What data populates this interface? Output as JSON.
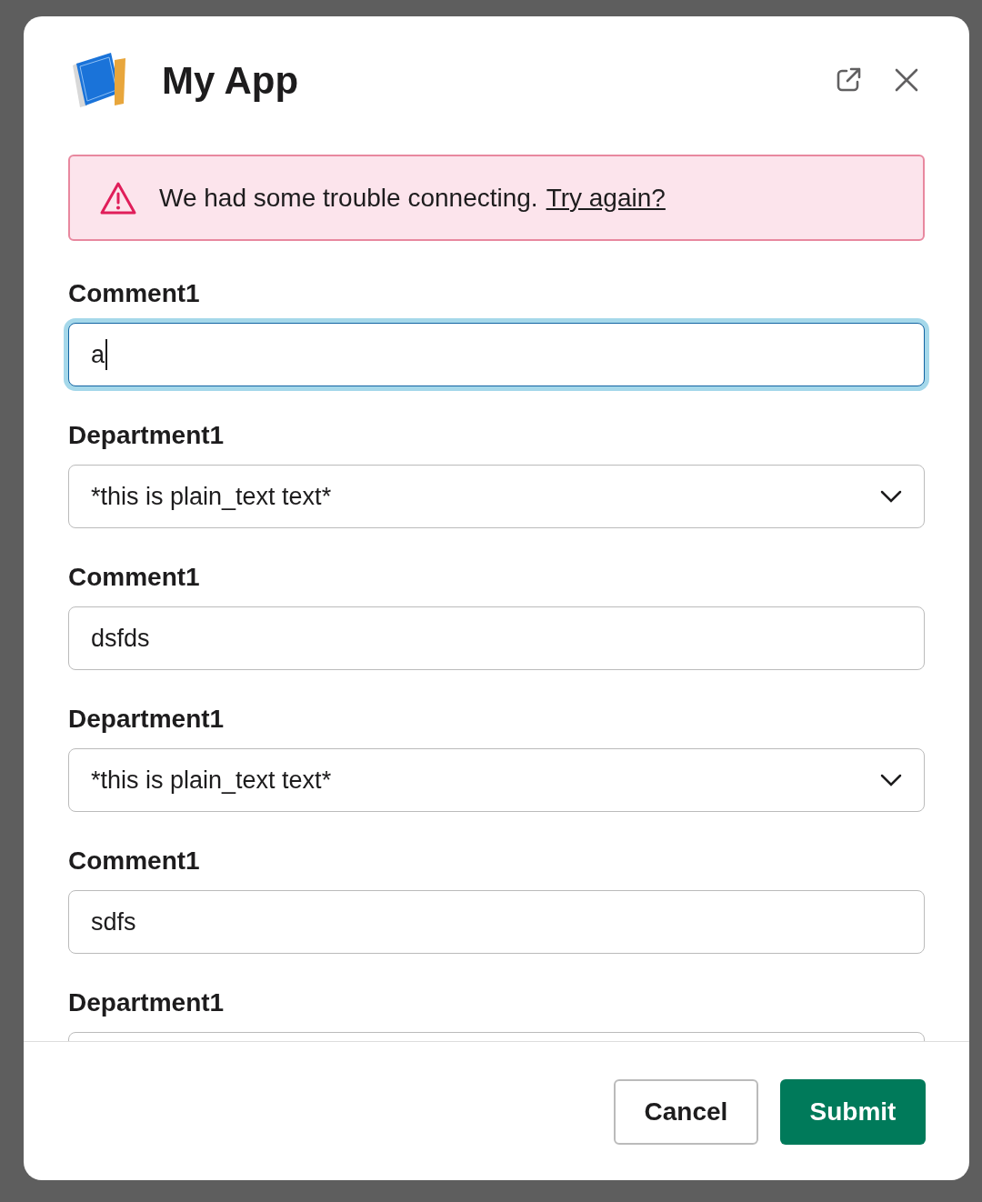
{
  "modal": {
    "title": "My App"
  },
  "alert": {
    "message": "We had some trouble connecting.",
    "link": "Try again?"
  },
  "fields": [
    {
      "kind": "text",
      "label": "Comment1",
      "value": "a",
      "focused": true
    },
    {
      "kind": "select",
      "label": "Department1",
      "value": "*this is plain_text text*",
      "focused": false
    },
    {
      "kind": "text",
      "label": "Comment1",
      "value": "dsfds",
      "focused": false
    },
    {
      "kind": "select",
      "label": "Department1",
      "value": "*this is plain_text text*",
      "focused": false
    },
    {
      "kind": "text",
      "label": "Comment1",
      "value": "sdfs",
      "focused": false
    },
    {
      "kind": "select",
      "label": "Department1",
      "focused": false
    }
  ],
  "buttons": [
    {
      "kind": "secondary",
      "label": "Cancel"
    },
    {
      "kind": "primary",
      "label": "Submit"
    }
  ]
}
